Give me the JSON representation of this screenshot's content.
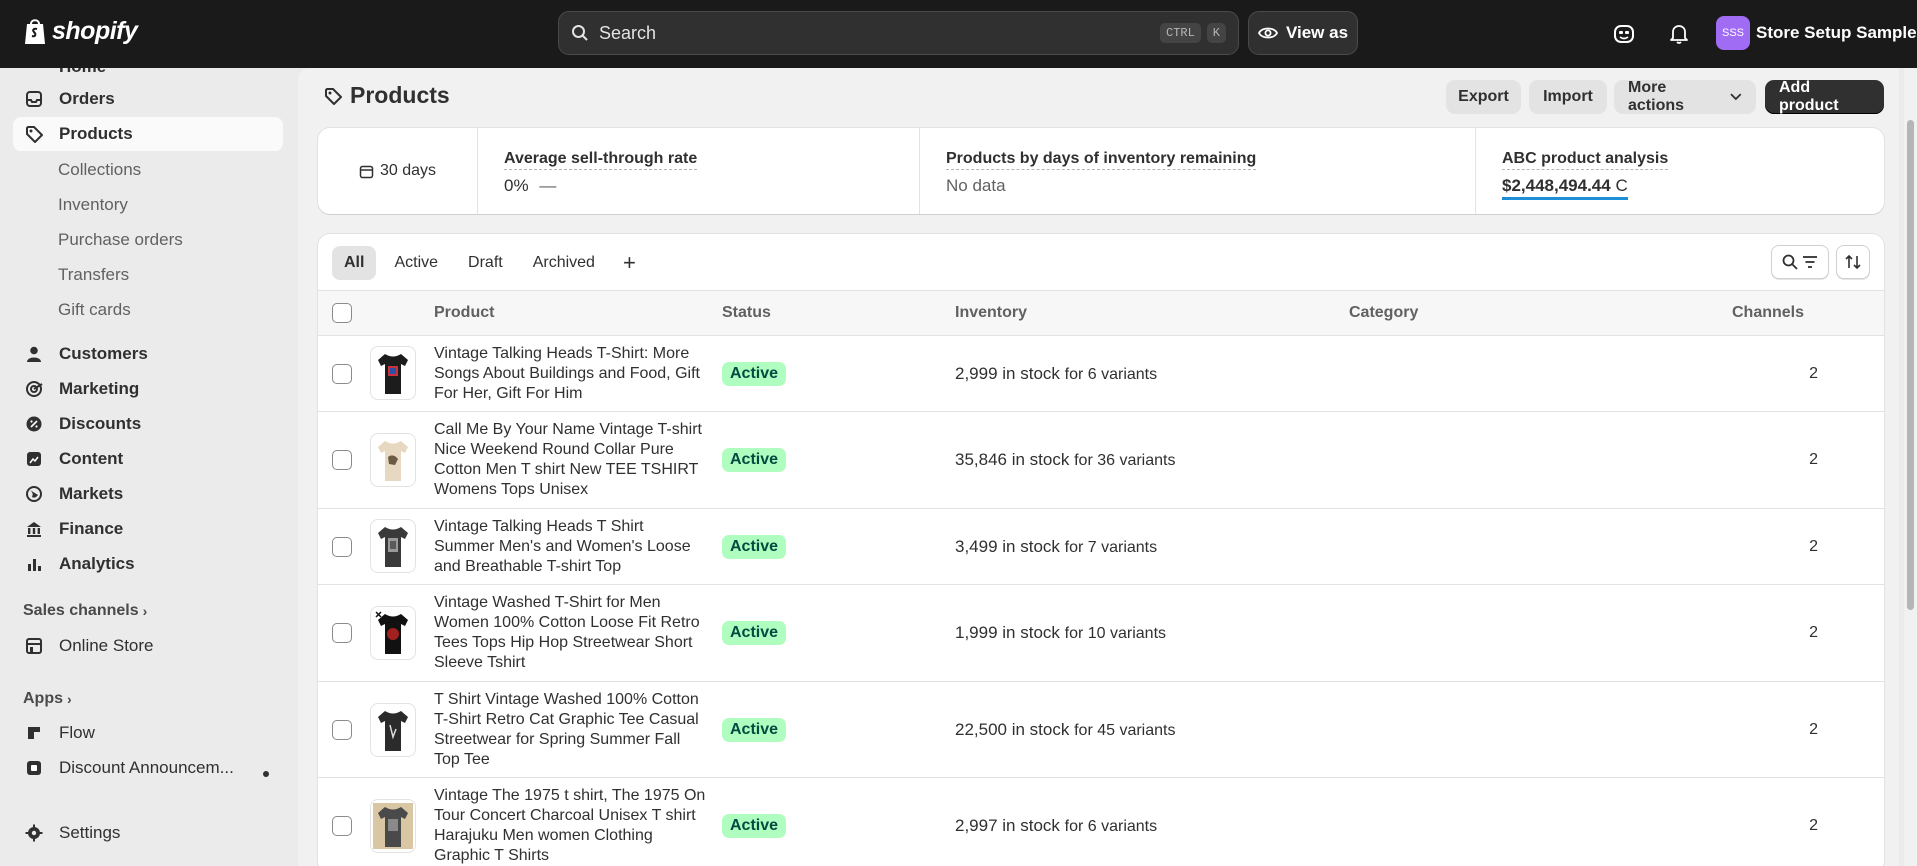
{
  "topbar": {
    "brand": "shopify",
    "search_placeholder": "Search",
    "kbd_ctrl": "CTRL",
    "kbd_k": "K",
    "view_as": "View as",
    "store_initials": "SSS",
    "store_name": "Store Setup Sample"
  },
  "sidebar": {
    "home": "Home",
    "orders": "Orders",
    "products": "Products",
    "sub": [
      "Collections",
      "Inventory",
      "Purchase orders",
      "Transfers",
      "Gift cards"
    ],
    "customers": "Customers",
    "marketing": "Marketing",
    "discounts": "Discounts",
    "content": "Content",
    "markets": "Markets",
    "finance": "Finance",
    "analytics": "Analytics",
    "sales_channels": "Sales channels",
    "online_store": "Online Store",
    "apps": "Apps",
    "flow": "Flow",
    "discount_app": "Discount Announcem...",
    "settings": "Settings"
  },
  "header": {
    "title": "Products",
    "export": "Export",
    "import": "Import",
    "more_actions": "More actions",
    "add_product": "Add product"
  },
  "metrics": {
    "days": "30 days",
    "sell_through_label": "Average sell-through rate",
    "sell_through_value": "0%",
    "sell_through_dash": "—",
    "days_inventory_label": "Products by days of inventory remaining",
    "days_inventory_value": "No data",
    "abc_label": "ABC product analysis",
    "abc_value": "$2,448,494.44",
    "abc_grade": "C"
  },
  "tabs": [
    "All",
    "Active",
    "Draft",
    "Archived"
  ],
  "table": {
    "headers": {
      "product": "Product",
      "status": "Status",
      "inventory": "Inventory",
      "category": "Category",
      "channels": "Channels"
    },
    "rows": [
      {
        "name": "Vintage Talking Heads T-Shirt: More Songs About Buildings and Food, Gift For Her, Gift For Him",
        "status": "Active",
        "stock": "2,999 in stock",
        "variants": "for 6 variants",
        "channels": "2"
      },
      {
        "name": "Call Me By Your Name Vintage T-shirt Nice Weekend Round Collar Pure Cotton Men T shirt New TEE TSHIRT Womens Tops Unisex",
        "status": "Active",
        "stock": "35,846 in stock",
        "variants": "for 36 variants",
        "channels": "2"
      },
      {
        "name": "Vintage Talking Heads T Shirt Summer Men's and Women's Loose and Breathable T-shirt Top",
        "status": "Active",
        "stock": "3,499 in stock",
        "variants": "for 7 variants",
        "channels": "2"
      },
      {
        "name": "Vintage Washed T-Shirt for Men Women 100% Cotton Loose Fit Retro Tees Tops Hip Hop Streetwear Short Sleeve Tshirt",
        "status": "Active",
        "stock": "1,999 in stock",
        "variants": "for 10 variants",
        "channels": "2"
      },
      {
        "name": "T Shirt Vintage Washed 100% Cotton T-Shirt Retro Cat Graphic Tee Casual Streetwear for Spring Summer Fall Top Tee",
        "status": "Active",
        "stock": "22,500 in stock",
        "variants": "for 45 variants",
        "channels": "2"
      },
      {
        "name": "Vintage The 1975 t shirt, The 1975 On Tour Concert Charcoal Unisex T shirt Harajuku Men women Clothing Graphic T Shirts",
        "status": "Active",
        "stock": "2,997 in stock",
        "variants": "for 6 variants",
        "channels": "2"
      }
    ]
  }
}
